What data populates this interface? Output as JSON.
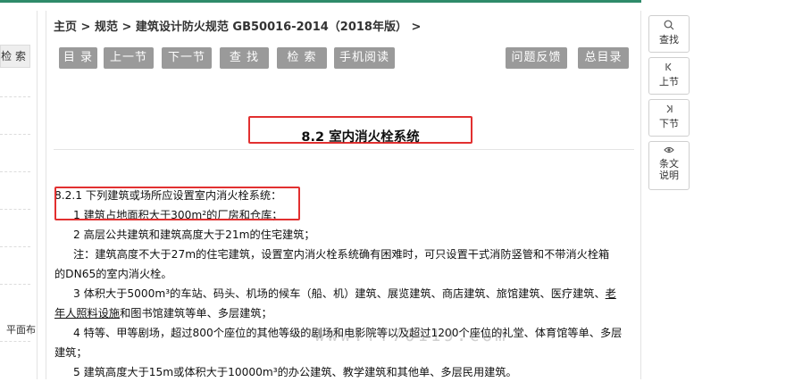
{
  "left": {
    "search_label": "检 索",
    "bottom_text": "平面布"
  },
  "breadcrumb": "主页 > 规范 > 建筑设计防火规范 GB50016-2014（2018年版） >",
  "toolbar": {
    "toc": "目 录",
    "prev": "上一节",
    "next": "下一节",
    "search": "查 找",
    "retrieve": "检 索",
    "mobile": "手机阅读",
    "feedback": "问题反馈",
    "catalog": "总目录"
  },
  "section_title": "8.2  室内消火栓系统",
  "content": {
    "l1": "8.2.1  下列建筑或场所应设置室内消火栓系统：",
    "l2": "1 建筑占地面积大于300m²的厂房和仓库；",
    "l3": "2 高层公共建筑和建筑高度大于21m的住宅建筑；",
    "l4": "注：建筑高度不大于27m的住宅建筑，设置室内消火栓系统确有困难时，可只设置干式消防竖管和不带消火栓箱",
    "l5": "的DN65的室内消火栓。",
    "l6a": "3 体积大于5000m³的车站、码头、机场的候车（船、机）建筑、展览建筑、商店建筑、旅馆建筑、医疗建筑、",
    "l6b": "老",
    "l7a": "年人照料设施",
    "l7b": "和图书馆建筑等单、多层建筑；",
    "l8": "4 特等、甲等剧场，超过800个座位的其他等级的剧场和电影院等以及超过1200个座位的礼堂、体育馆等单、多层",
    "l9": "建筑；",
    "l10": "5 建筑高度大于15m或体积大于10000m³的办公建筑、教学建筑和其他单、多层民用建筑。"
  },
  "watermark": "www.ff70119.com",
  "right_tools": {
    "find": "查找",
    "prev": "上节",
    "next": "下节",
    "explain": "条文说明"
  },
  "colors": {
    "topbar": "#2e8b6a",
    "button": "#9a9a9a",
    "highlight": "#e23030"
  },
  "icons": [
    "search-icon",
    "prev-section-icon",
    "next-section-icon",
    "eye-icon"
  ]
}
